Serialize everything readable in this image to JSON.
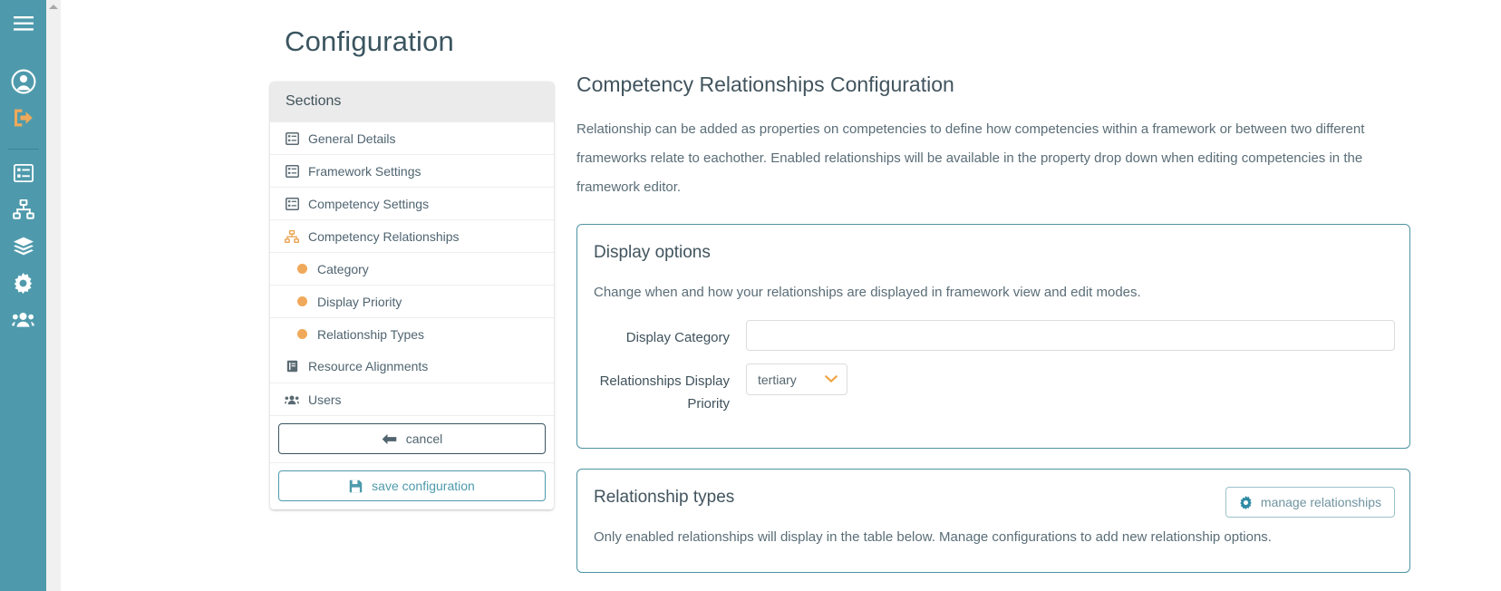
{
  "sidebar": {
    "icons": [
      {
        "name": "hamburger-menu-icon",
        "label": "menu"
      },
      {
        "name": "user-account-icon",
        "label": "account"
      },
      {
        "name": "logout-icon",
        "label": "logout"
      },
      {
        "name": "list-icon",
        "label": "lists"
      },
      {
        "name": "sitemap-icon",
        "label": "frameworks"
      },
      {
        "name": "layers-icon",
        "label": "collections"
      },
      {
        "name": "gear-icon",
        "label": "settings"
      },
      {
        "name": "users-icon",
        "label": "users"
      }
    ],
    "accent_color": "#4e9aac",
    "logout_color": "#f0a95a"
  },
  "page": {
    "title": "Configuration"
  },
  "sections_panel": {
    "header": "Sections",
    "items": [
      {
        "label": "General Details",
        "icon": "table-list-icon",
        "sub": false
      },
      {
        "label": "Framework Settings",
        "icon": "table-list-icon",
        "sub": false
      },
      {
        "label": "Competency Settings",
        "icon": "table-list-icon",
        "sub": false
      },
      {
        "label": "Competency Relationships",
        "icon": "sitemap-icon",
        "sub": false
      },
      {
        "label": "Category",
        "icon": "dot-icon",
        "sub": true
      },
      {
        "label": "Display Priority",
        "icon": "dot-icon",
        "sub": true
      },
      {
        "label": "Relationship Types",
        "icon": "dot-icon",
        "sub": true
      },
      {
        "label": "Resource Alignments",
        "icon": "book-icon",
        "sub": false
      },
      {
        "label": "Users",
        "icon": "users-icon",
        "sub": false
      }
    ],
    "cancel_label": "cancel",
    "save_label": "save configuration",
    "dot_color": "#f0a95a"
  },
  "main": {
    "heading": "Competency Relationships Configuration",
    "description": "Relationship can be added as properties on competencies to define how competencies within a framework or between two different frameworks relate to eachother. Enabled relationships will be available in the property drop down when editing competencies in the framework editor.",
    "display_options": {
      "title": "Display options",
      "description": "Change when and how your relationships are displayed in framework view and edit modes.",
      "display_category_label": "Display Category",
      "display_category_value": "",
      "display_category_placeholder": "",
      "display_priority_label": "Relationships Display Priority",
      "display_priority_value": "tertiary"
    },
    "relationship_types": {
      "title": "Relationship types",
      "manage_button_label": "manage relationships",
      "description": "Only enabled relationships will display in the table below. Manage configurations to add new relationship options."
    }
  },
  "colors": {
    "teal": "#4e9aac",
    "card_border": "#4e94a3",
    "orange": "#f0a95a",
    "text": "#41545e"
  }
}
